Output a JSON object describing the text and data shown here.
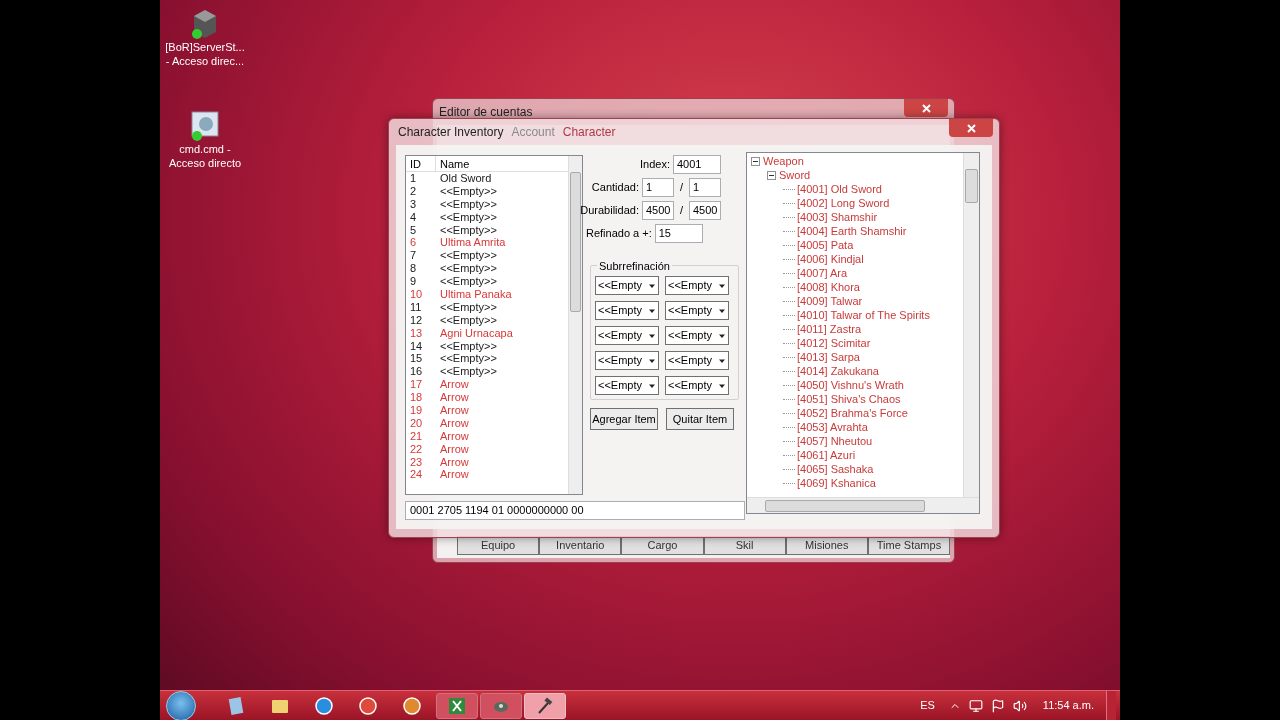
{
  "desktop_icons": [
    {
      "kind": "server",
      "label_lines": [
        "[BoR]ServerSt...",
        "- Acceso direc..."
      ]
    },
    {
      "kind": "script",
      "label_lines": [
        "cmd.cmd -",
        "Acceso directo"
      ]
    }
  ],
  "back_window": {
    "title": "Editor de cuentas",
    "tabs": [
      {
        "label": "Account",
        "selected": false
      },
      {
        "label": "Character",
        "selected": true
      }
    ],
    "buttons": [
      "Equipo",
      "Inventario",
      "Cargo",
      "Skil",
      "Misiones",
      "Time Stamps"
    ]
  },
  "front_window": {
    "title": "Character Inventory",
    "list": {
      "columns": [
        "ID",
        "Name"
      ],
      "rows": [
        {
          "id": "1",
          "name": "Old Sword",
          "color": "#202020"
        },
        {
          "id": "2",
          "name": "<<Empty>>",
          "color": "#202020"
        },
        {
          "id": "3",
          "name": "<<Empty>>",
          "color": "#202020"
        },
        {
          "id": "4",
          "name": "<<Empty>>",
          "color": "#202020"
        },
        {
          "id": "5",
          "name": "<<Empty>>",
          "color": "#202020"
        },
        {
          "id": "6",
          "name": "Ultima Amrita",
          "color": "#d83838"
        },
        {
          "id": "7",
          "name": "<<Empty>>",
          "color": "#202020"
        },
        {
          "id": "8",
          "name": "<<Empty>>",
          "color": "#202020"
        },
        {
          "id": "9",
          "name": "<<Empty>>",
          "color": "#202020"
        },
        {
          "id": "10",
          "name": "Ultima Panaka",
          "color": "#d83838"
        },
        {
          "id": "11",
          "name": "<<Empty>>",
          "color": "#202020"
        },
        {
          "id": "12",
          "name": "<<Empty>>",
          "color": "#202020"
        },
        {
          "id": "13",
          "name": "Agni Urnacapa",
          "color": "#d83838"
        },
        {
          "id": "14",
          "name": "<<Empty>>",
          "color": "#202020"
        },
        {
          "id": "15",
          "name": "<<Empty>>",
          "color": "#202020"
        },
        {
          "id": "16",
          "name": "<<Empty>>",
          "color": "#202020"
        },
        {
          "id": "17",
          "name": "Arrow",
          "color": "#d83838"
        },
        {
          "id": "18",
          "name": "Arrow",
          "color": "#d83838"
        },
        {
          "id": "19",
          "name": "Arrow",
          "color": "#d83838"
        },
        {
          "id": "20",
          "name": "Arrow",
          "color": "#d83838"
        },
        {
          "id": "21",
          "name": "Arrow",
          "color": "#d83838"
        },
        {
          "id": "22",
          "name": "Arrow",
          "color": "#d83838"
        },
        {
          "id": "23",
          "name": "Arrow",
          "color": "#d83838"
        },
        {
          "id": "24",
          "name": "Arrow",
          "color": "#d83838"
        }
      ]
    },
    "form": {
      "index_label": "Index:",
      "index": "4001",
      "cantidad_label": "Cantidad:",
      "cantidad": "1",
      "cantidad_max": "1",
      "durabilidad_label": "Durabilidad:",
      "durabilidad": "4500",
      "durabilidad_max": "4500",
      "separator": "/",
      "refinado_label": "Refinado a +:",
      "refinado": "15"
    },
    "subrefinacion": {
      "title": "Subrrefinación",
      "slots": [
        [
          "<<Empty",
          "<<Empty"
        ],
        [
          "<<Empty",
          "<<Empty"
        ],
        [
          "<<Empty",
          "<<Empty"
        ],
        [
          "<<Empty",
          "<<Empty"
        ],
        [
          "<<Empty",
          "<<Empty"
        ]
      ]
    },
    "buttons": [
      "Agregar Item",
      "Quitar Item"
    ],
    "tree": [
      {
        "label": "Weapon",
        "expanded": true,
        "children": [
          {
            "label": "Sword",
            "expanded": true,
            "children": [
              {
                "label": "[4001] Old Sword"
              },
              {
                "label": "[4002] Long Sword"
              },
              {
                "label": "[4003] Shamshir"
              },
              {
                "label": "[4004] Earth Shamshir"
              },
              {
                "label": "[4005] Pata"
              },
              {
                "label": "[4006] Kindjal"
              },
              {
                "label": "[4007] Ara"
              },
              {
                "label": "[4008] Khora"
              },
              {
                "label": "[4009] Talwar"
              },
              {
                "label": "[4010] Talwar of The Spirits"
              },
              {
                "label": "[4011] Zastra"
              },
              {
                "label": "[4012] Scimitar"
              },
              {
                "label": "[4013] Sarpa"
              },
              {
                "label": "[4014] Zakukana"
              },
              {
                "label": "[4050] Vishnu's Wrath"
              },
              {
                "label": "[4051] Shiva's Chaos"
              },
              {
                "label": "[4052] Brahma's Force"
              },
              {
                "label": "[4053] Avrahta"
              },
              {
                "label": "[4057] Nheutou"
              },
              {
                "label": "[4061] Azuri"
              },
              {
                "label": "[4065] Sashaka"
              },
              {
                "label": "[4069] Kshanica"
              }
            ]
          }
        ]
      }
    ],
    "status_field": "0001 2705 1194 01 0000000000 00"
  },
  "taskbar": {
    "pinned": [
      {
        "kind": "notepad"
      },
      {
        "kind": "folder"
      },
      {
        "kind": "browser-e"
      },
      {
        "kind": "browser-c"
      },
      {
        "kind": "app"
      }
    ],
    "windows": [
      {
        "kind": "spreadsheet",
        "active": false
      },
      {
        "kind": "tool",
        "active": false
      },
      {
        "kind": "hammer",
        "active": true
      }
    ],
    "language": "ES",
    "time": "11:54 a.m."
  }
}
